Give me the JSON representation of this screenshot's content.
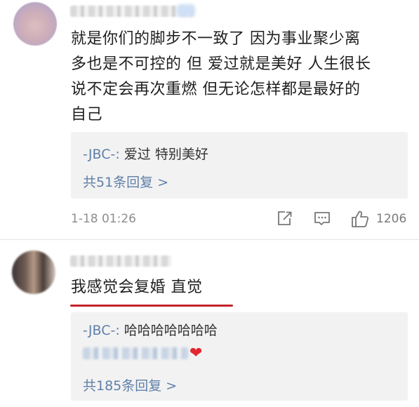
{
  "comments": [
    {
      "text_lines": [
        "就是你们的脚步不一致了  因为事业聚少离",
        "多也是不可控的  但 爱过就是美好 人生很长",
        "说不定会再次重燃  但无论怎样都是最好的",
        "自己"
      ],
      "reply_author": "-JBC-:",
      "reply_text": " 爱过 特别美好",
      "more_replies": "共51条回复 >",
      "time": "1-18 01:26",
      "like_count": "1206"
    },
    {
      "text": "我感觉会复婚 直觉",
      "reply_author": "-JBC-:",
      "reply_text": " 哈哈哈哈哈哈哈",
      "reply2_icon": "heart-emoji",
      "more_replies": "共185条回复 >"
    }
  ],
  "icons": {
    "share": "share-icon",
    "reply": "comment-icon",
    "like": "thumbs-up-icon"
  },
  "colors": {
    "link": "#5f7fa8",
    "underline": "#c4232a",
    "heart": "#e3262f"
  }
}
